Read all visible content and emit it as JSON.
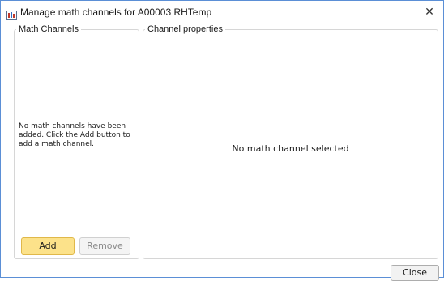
{
  "window": {
    "title": "Manage math channels for A00003 RHTemp",
    "close_glyph": "✕",
    "icon": "app-icon"
  },
  "math_channels_group": {
    "legend": "Math Channels",
    "empty_message": "No math channels have been added. Click the Add button to add a math channel.",
    "add_label": "Add",
    "remove_label": "Remove"
  },
  "properties_group": {
    "legend": "Channel properties",
    "empty_message": "No math channel selected"
  },
  "footer": {
    "close_label": "Close"
  },
  "colors": {
    "window_border": "#5b8fd6",
    "add_button_bg": "#fce28a",
    "add_button_border": "#e0b84a",
    "group_border": "#d6d6d6"
  }
}
